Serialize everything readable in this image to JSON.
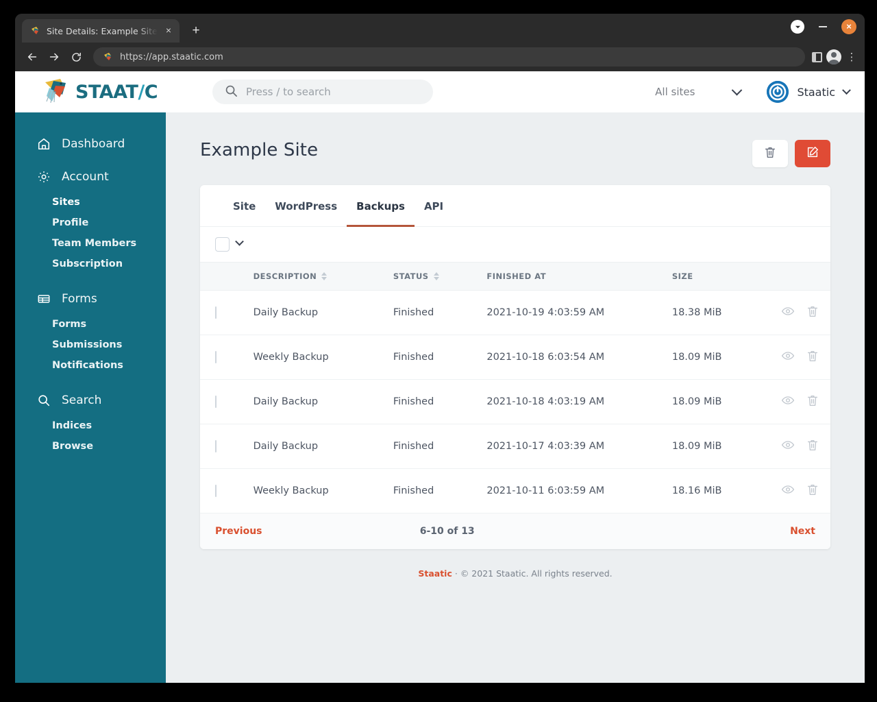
{
  "browser": {
    "tab_title": "Site Details: Example Site | Sta",
    "tab_close_label": "×",
    "newtab_label": "+",
    "url": "https://app.staatic.com",
    "close_label": "×",
    "back_icon": "back-arrow-icon",
    "forward_icon": "forward-arrow-icon",
    "reload_icon": "reload-icon"
  },
  "header": {
    "logo_main": "STAAT",
    "logo_slash": "/",
    "logo_tail": "C",
    "search_placeholder": "Press / to search",
    "site_selector": "All sites",
    "user_name": "Staatic"
  },
  "sidebar": {
    "groups": [
      {
        "icon": "home-icon",
        "label": "Dashboard",
        "items": []
      },
      {
        "icon": "gear-icon",
        "label": "Account",
        "items": [
          {
            "label": "Sites",
            "active": true
          },
          {
            "label": "Profile",
            "active": false
          },
          {
            "label": "Team Members",
            "active": false
          },
          {
            "label": "Subscription",
            "active": false
          }
        ]
      },
      {
        "icon": "table-icon",
        "label": "Forms",
        "items": [
          {
            "label": "Forms",
            "active": false
          },
          {
            "label": "Submissions",
            "active": false
          },
          {
            "label": "Notifications",
            "active": false
          }
        ]
      },
      {
        "icon": "search-icon",
        "label": "Search",
        "items": [
          {
            "label": "Indices",
            "active": false
          },
          {
            "label": "Browse",
            "active": false
          }
        ]
      }
    ]
  },
  "page": {
    "title": "Example Site",
    "actions": [
      {
        "name": "delete-site-button",
        "icon": "trash-icon",
        "style": "white"
      },
      {
        "name": "edit-site-button",
        "icon": "edit-icon",
        "style": "red"
      }
    ],
    "tabs": [
      {
        "label": "Site",
        "active": false
      },
      {
        "label": "WordPress",
        "active": false
      },
      {
        "label": "Backups",
        "active": true
      },
      {
        "label": "API",
        "active": false
      }
    ]
  },
  "table": {
    "columns": [
      {
        "label": "Description",
        "sortable": true
      },
      {
        "label": "Status",
        "sortable": true
      },
      {
        "label": "Finished at",
        "sortable": false
      },
      {
        "label": "Size",
        "sortable": false
      }
    ],
    "rows": [
      {
        "description": "Daily Backup",
        "status": "Finished",
        "finished_at": "2021-10-19 4:03:59 AM",
        "size": "18.38 MiB"
      },
      {
        "description": "Weekly Backup",
        "status": "Finished",
        "finished_at": "2021-10-18 6:03:54 AM",
        "size": "18.09 MiB"
      },
      {
        "description": "Daily Backup",
        "status": "Finished",
        "finished_at": "2021-10-18 4:03:19 AM",
        "size": "18.09 MiB"
      },
      {
        "description": "Daily Backup",
        "status": "Finished",
        "finished_at": "2021-10-17 4:03:39 AM",
        "size": "18.09 MiB"
      },
      {
        "description": "Weekly Backup",
        "status": "Finished",
        "finished_at": "2021-10-11 6:03:59 AM",
        "size": "18.16 MiB"
      }
    ],
    "row_actions": [
      {
        "name": "view-backup-icon",
        "icon": "eye-icon"
      },
      {
        "name": "delete-backup-icon",
        "icon": "trash-icon"
      }
    ]
  },
  "pagination": {
    "previous": "Previous",
    "range": "6-10 of 13",
    "next": "Next"
  },
  "footer": {
    "brand": "Staatic",
    "separator": "·",
    "copyright": "© 2021 Staatic. All rights reserved."
  },
  "colors": {
    "sidebar": "#146e82",
    "accent_red": "#e04b35",
    "link_red": "#d9502f",
    "tab_underline": "#b5563a",
    "logo_teal": "#1b6d80",
    "page_bg": "#eceff1"
  }
}
